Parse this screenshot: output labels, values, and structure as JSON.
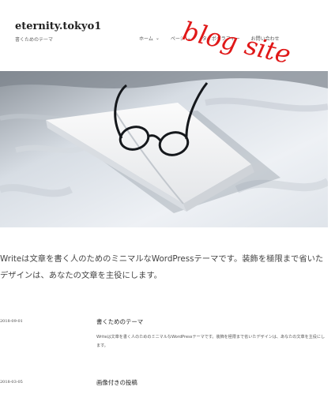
{
  "site": {
    "title": "eternity.tokyo1",
    "tagline": "書くためのテーマ"
  },
  "nav": {
    "items": [
      {
        "label": "ホーム",
        "has_dropdown": true
      },
      {
        "label": "ページ",
        "has_dropdown": true
      },
      {
        "label": "タイポグラフィー",
        "has_dropdown": false
      },
      {
        "label": "お問い合わせ",
        "has_dropdown": false
      }
    ]
  },
  "overlay": {
    "text": "blog site",
    "color": "#e01818"
  },
  "intro": {
    "text": "Writeは文章を書く人のためのミニマルなWordPressテーマです。装飾を極限まで省いたデザインは、あなたの文章を主役にします。"
  },
  "posts": [
    {
      "date": "2018-09-01",
      "title": "書くためのテーマ",
      "excerpt": "Writeは文章を書く人のためのミニマルなWordPressテーマです。装飾を極限まで省いたデザインは、あなたの文章を主役にします。"
    },
    {
      "date": "2018-03-05",
      "title": "画像付きの投稿",
      "excerpt": ""
    }
  ]
}
